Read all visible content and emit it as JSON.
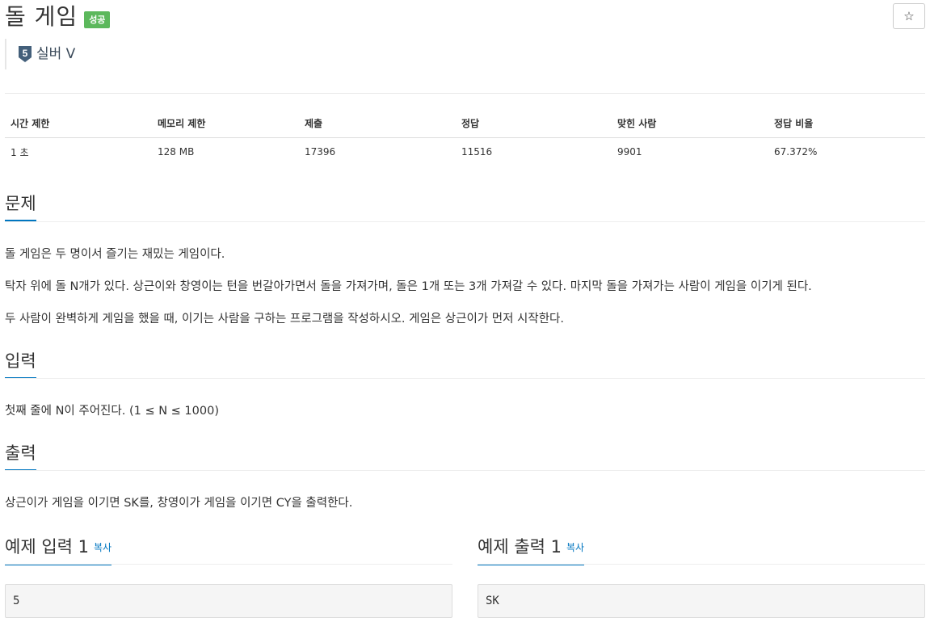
{
  "problem": {
    "title": "돌 게임",
    "status_badge": "성공",
    "tier_number": "5",
    "tier_label": "실버 V",
    "star_icon": "☆"
  },
  "info": {
    "headers": [
      "시간 제한",
      "메모리 제한",
      "제출",
      "정답",
      "맞힌 사람",
      "정답 비율"
    ],
    "values": [
      "1 초",
      "128 MB",
      "17396",
      "11516",
      "9901",
      "67.372%"
    ]
  },
  "sections": {
    "problem_title": "문제",
    "problem_lines": [
      "돌 게임은 두 명이서 즐기는 재밌는 게임이다.",
      "탁자 위에 돌 N개가 있다. 상근이와 창영이는 턴을 번갈아가면서 돌을 가져가며, 돌은 1개 또는 3개 가져갈 수 있다. 마지막 돌을 가져가는 사람이 게임을 이기게 된다.",
      "두 사람이 완벽하게 게임을 했을 때, 이기는 사람을 구하는 프로그램을 작성하시오. 게임은 상근이가 먼저 시작한다."
    ],
    "input_title": "입력",
    "input_text": "첫째 줄에 N이 주어진다. (1 ≤ N ≤ 1000)",
    "output_title": "출력",
    "output_text": "상근이가 게임을 이기면 SK를, 창영이가 게임을 이기면 CY을 출력한다."
  },
  "samples": {
    "input_title": "예제 입력 1",
    "output_title": "예제 출력 1",
    "copy_label": "복사",
    "input_value": "5",
    "output_value": "SK"
  },
  "colors": {
    "success": "#5cb85c",
    "accent": "#0076c0",
    "tier_silver": "#435f7a"
  }
}
